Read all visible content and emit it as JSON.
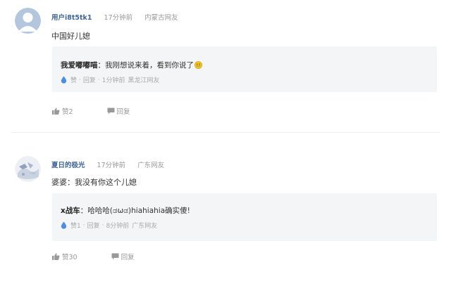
{
  "comments": [
    {
      "username": "用户i8t5tk1",
      "time": "17分钟前",
      "location": "内蒙古网友",
      "text": "中国好儿媳",
      "reply": {
        "username": "我爱嘟嘟喵",
        "text": "：我刚想说来着，看到你说了",
        "like_label": "赞",
        "reply_label": "回复",
        "time": "1分钟前",
        "location": "黑龙江网友"
      },
      "like_label": "赞2",
      "reply_label": "回复"
    },
    {
      "username": "夏日的极光",
      "time": "17分钟前",
      "location": "广东网友",
      "text": "婆婆：我没有你这个儿媳",
      "reply": {
        "username": "x战车",
        "text": "：哈哈哈(ಡωಡ)hiahiahia确实傻!",
        "like_label": "赞1",
        "reply_label": "回复",
        "time": "8分钟前",
        "location": "广东网友"
      },
      "like_label": "赞30",
      "reply_label": "回复"
    }
  ],
  "colors": {
    "username": "#406599",
    "accent_blue": "#4a90e2",
    "reply_bg": "#f4f5f6"
  },
  "icons": [
    "default-avatar-icon",
    "drop-icon",
    "thumb-up-icon",
    "comment-bubble-icon",
    "grin-emoji-icon"
  ]
}
